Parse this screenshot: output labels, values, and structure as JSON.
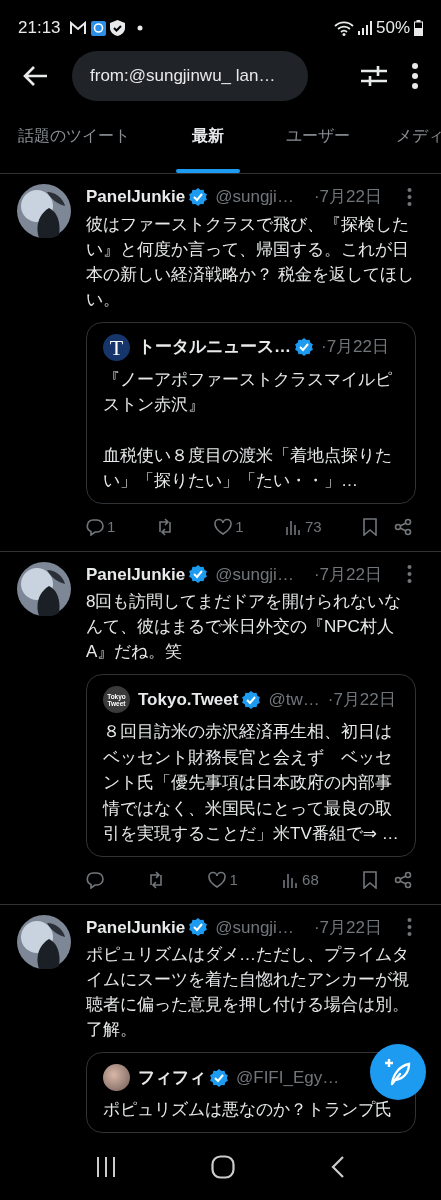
{
  "status_bar": {
    "time": "21:13",
    "battery": "50%"
  },
  "search": {
    "value": "from:@sungjinwu_ lan…"
  },
  "tabs": [
    {
      "label": "話題のツイート",
      "selected": false
    },
    {
      "label": "最新",
      "selected": true
    },
    {
      "label": "ユーザー",
      "selected": false
    },
    {
      "label": "メディ",
      "selected": false
    }
  ],
  "tweets": [
    {
      "name": "PanelJunkie",
      "verified": true,
      "handle": "@sungji…",
      "date": "·7月22日",
      "text": "彼はファーストクラスで飛び、『探検したい』と何度か言って、帰国する。これが日本の新しい経済戦略か？ 税金を返してほしい。",
      "quote": {
        "avatar": {
          "kind": "letter",
          "text": "T"
        },
        "name": "トータルニュース…",
        "verified": true,
        "date": "·7月22日",
        "paragraphs": [
          "『ノーアポファーストクラスマイルピストン赤沢』",
          "血税使い８度目の渡米「着地点探りたい」「探りたい」「たい・・」…"
        ]
      },
      "actions": {
        "replies": "1",
        "likes": "1",
        "views": "73"
      }
    },
    {
      "name": "PanelJunkie",
      "verified": true,
      "handle": "@sungji…",
      "date": "·7月22日",
      "text": "8回も訪問してまだドアを開けられないなんて、彼はまるで米日外交の『NPC村人A』だね。笑",
      "quote": {
        "avatar": {
          "kind": "logo",
          "text": "Tokyo Tweet"
        },
        "name": "Tokyo.Tweet",
        "verified": true,
        "handle": "@tw…",
        "date": "·7月22日",
        "paragraphs": [
          "８回目訪米の赤沢経済再生相、初日はベッセント財務長官と会えず　ベッセント氏「優先事項は日本政府の内部事情ではなく、米国民にとって最良の取引を実現することだ」米TV番組で⇒ …"
        ]
      },
      "actions": {
        "likes": "1",
        "views": "68"
      }
    },
    {
      "name": "PanelJunkie",
      "verified": true,
      "handle": "@sungji…",
      "date": "·7月22日",
      "text": "ポピュリズムはダメ…ただし、プライムタイムにスーツを着た自惚れたアンカーが視聴者に偏った意見を押し付ける場合は別。了解。",
      "quote": {
        "avatar": {
          "kind": "photo"
        },
        "name": "フィフィ",
        "verified": true,
        "handle": "@FIFI_Egy…",
        "paragraphs": [
          "ポピュリズムは悪なのか？トランプ氏"
        ]
      }
    }
  ]
}
